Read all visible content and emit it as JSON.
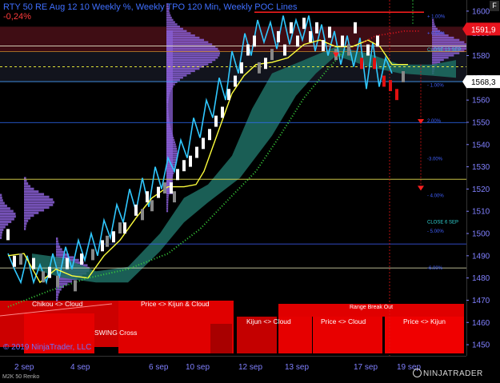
{
  "header": {
    "title": "RTY 50 RE Aug 12 10 Weekly %, Weekly TPO 120 Min, Weekly POC Lines",
    "change_pct": "-0,24%",
    "copyright": "© 2019 NinjaTrader, LLC",
    "instrument_label": "M2K 50 Renko",
    "logo_text": "NINJATRADER",
    "corner_badge": "F"
  },
  "colors": {
    "background": "#000000",
    "axis_text": "#8080ff",
    "price_tag_red": "#e8141e",
    "tenkan_line": "#ffff3c",
    "kijun_line": "#30c8ff",
    "cloud": "#1f6e64",
    "dotted_ma": "#39d23c",
    "dotted_red": "#e6141e",
    "tpo_profile": "#8a5fd6",
    "signal_box": "#e60000"
  },
  "chart_data": {
    "type": "candlestick",
    "y_axis": {
      "min": 1445,
      "max": 1605,
      "ticks": [
        1450,
        1460,
        1470,
        1480,
        1490,
        1500,
        1510,
        1520,
        1530,
        1540,
        1550,
        1560,
        1570,
        1580,
        1590,
        1600
      ],
      "side": "right"
    },
    "x_ticks": [
      "2 sep",
      "4 sep",
      "6 sep",
      "10 sep",
      "12 sep",
      "13 sep",
      "17 sep",
      "19 sep"
    ],
    "current_price_tags": [
      {
        "label": "1591,9",
        "value": 1591.9,
        "style": "red"
      },
      {
        "label": "1568,3",
        "value": 1568.3,
        "style": "white"
      }
    ],
    "level_labels": [
      {
        "text": "+ 1.00%",
        "value": 1598
      },
      {
        "text": "+ 0.50%",
        "value": 1590.5
      },
      {
        "text": "CLOSE 13 SEP",
        "value": 1583
      },
      {
        "text": "- 1.00%",
        "value": 1567
      },
      {
        "text": "2.00%",
        "value": 1551
      },
      {
        "text": "-3.00%",
        "value": 1534
      },
      {
        "text": "- 4.00%",
        "value": 1517.5
      },
      {
        "text": "CLOSE 6 SEP",
        "value": 1505.5
      },
      {
        "text": "- 5.00%",
        "value": 1501.5
      },
      {
        "text": "-6.00%",
        "value": 1485
      }
    ],
    "horizontal_levels": [
      1584.3,
      1581.8,
      1568.3,
      1549.9,
      1524.4,
      1495.3,
      1484.5,
      1575
    ],
    "signal_labels": [
      "Chikou <> Cloud",
      "Price <> Kijun & Cloud",
      "SWING Cross",
      "Range Break Out",
      "Kijun <> Cloud",
      "Price <> Cloud",
      "Price <> Kijun"
    ]
  }
}
